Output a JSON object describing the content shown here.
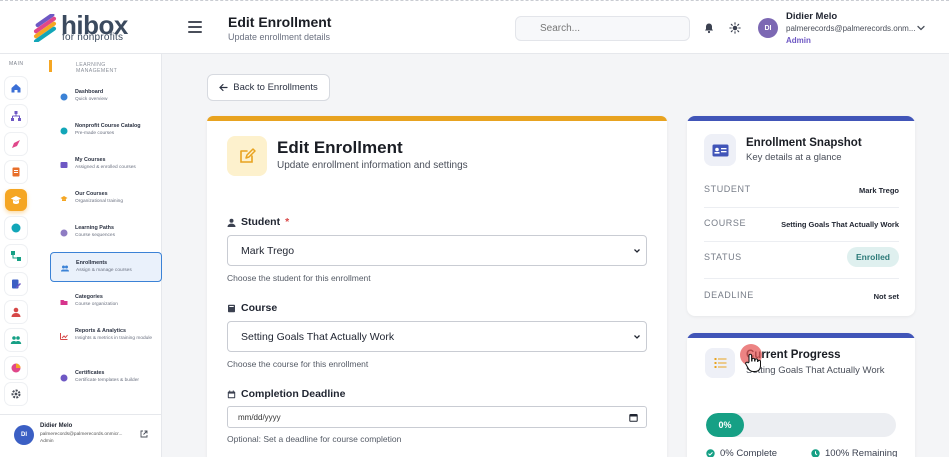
{
  "brand": {
    "word": "hibox",
    "sub": "for nonprofits"
  },
  "header": {
    "title": "Edit Enrollment",
    "subtitle": "Update enrollment details",
    "search_placeholder": "Search...",
    "user": {
      "name": "Didier Melo",
      "email": "palmerecords@palmerecords.onm...",
      "role": "Admin",
      "initials": "DI"
    }
  },
  "rail": {
    "section_label": "MAIN"
  },
  "menu": {
    "section_label": "LEARNING MANAGEMENT",
    "items": [
      {
        "title": "Dashboard",
        "desc": "Quick overview",
        "color": "#3b82d6"
      },
      {
        "title": "Nonprofit Course Catalog",
        "desc": "Pre-made courses",
        "color": "#12a6b8"
      },
      {
        "title": "My Courses",
        "desc": "Assigned & enrolled courses",
        "color": "#6e58c4"
      },
      {
        "title": "Our Courses",
        "desc": "Organizational training",
        "color": "#f5a623"
      },
      {
        "title": "Learning Paths",
        "desc": "Course sequences",
        "color": "#8e7cc3"
      },
      {
        "title": "Enrollments",
        "desc": "Assign & manage courses",
        "color": "#3b82d6"
      },
      {
        "title": "Categories",
        "desc": "Course organization",
        "color": "#d6348c"
      },
      {
        "title": "Reports & Analytics",
        "desc": "Insights & metrics in training module",
        "color": "#d64848"
      },
      {
        "title": "Certificates",
        "desc": "Certificate templates & builder",
        "color": "#6e58c4"
      }
    ]
  },
  "sidebar_footer": {
    "name": "Didier Melo",
    "email": "palmerecords@palmerecords.onmicr...",
    "role": "Admin",
    "initials": "DI"
  },
  "back_label": "Back to Enrollments",
  "form": {
    "title": "Edit Enrollment",
    "subtitle": "Update enrollment information and settings",
    "student": {
      "label": "Student",
      "required": "*",
      "value": "Mark Trego",
      "help": "Choose the student for this enrollment"
    },
    "course": {
      "label": "Course",
      "value": "Setting Goals That Actually Work",
      "help": "Choose the course for this enrollment"
    },
    "deadline": {
      "label": "Completion Deadline",
      "placeholder": "mm/dd/yyyy",
      "help": "Optional: Set a deadline for course completion"
    }
  },
  "snapshot": {
    "title": "Enrollment Snapshot",
    "subtitle": "Key details at a glance",
    "rows": {
      "student": {
        "key": "STUDENT",
        "value": "Mark Trego"
      },
      "course": {
        "key": "COURSE",
        "value": "Setting Goals That Actually Work"
      },
      "status": {
        "key": "STATUS",
        "value": "Enrolled"
      },
      "deadline": {
        "key": "DEADLINE",
        "value": "Not set"
      }
    }
  },
  "progress": {
    "title": "Current Progress",
    "subtitle": "Setting Goals That Actually Work",
    "percent": 0,
    "percent_label": "0%",
    "complete_label": "0% Complete",
    "remaining_label": "100% Remaining"
  },
  "colors": {
    "accent_orange": "#f5a623",
    "accent_blue": "#4155b8",
    "progress_green": "#16a085",
    "admin_purple": "#6e58c4"
  }
}
